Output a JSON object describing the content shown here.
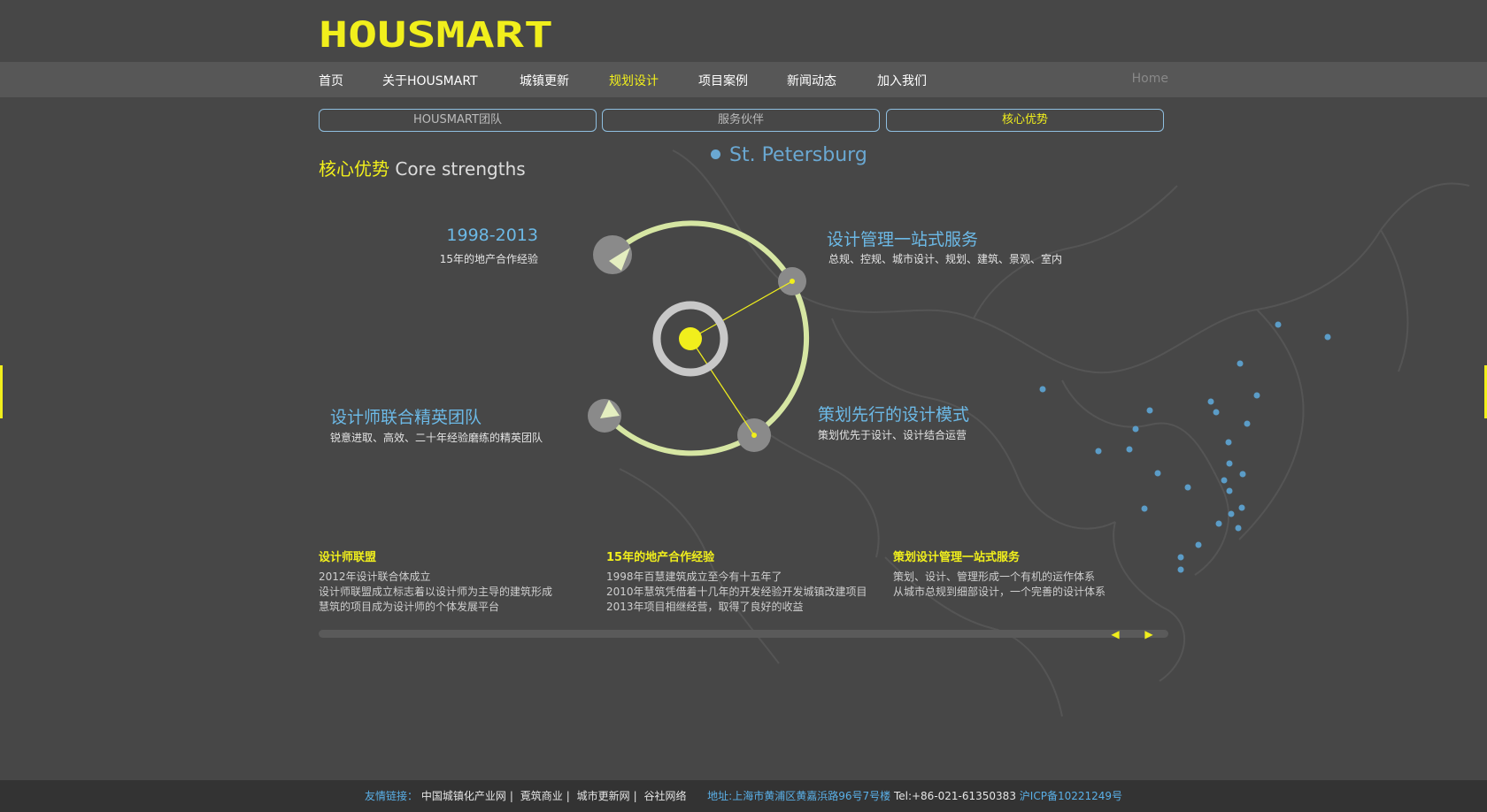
{
  "header": {
    "logo_text": "HOUSMART"
  },
  "nav": {
    "items": [
      {
        "label": "首页",
        "active": false
      },
      {
        "label": "关于HOUSMART",
        "active": false
      },
      {
        "label": "城镇更新",
        "active": false
      },
      {
        "label": "规划设计",
        "active": true
      },
      {
        "label": "项目案例",
        "active": false
      },
      {
        "label": "新闻动态",
        "active": false
      },
      {
        "label": "加入我们",
        "active": false
      }
    ],
    "home_label": "Home"
  },
  "subtabs": [
    {
      "label": "HOUSMART团队",
      "active": false
    },
    {
      "label": "服务伙伴",
      "active": false
    },
    {
      "label": "核心优势",
      "active": true
    }
  ],
  "section": {
    "title_cn": "核心优势",
    "title_en": " Core strengths"
  },
  "map": {
    "city_label": "St. Petersburg"
  },
  "callouts": {
    "top_left": {
      "title": "1998-2013",
      "subtitle": "15年的地产合作经验"
    },
    "top_right": {
      "title": "设计管理一站式服务",
      "subtitle": "总规、控规、城市设计、规划、建筑、景观、室内"
    },
    "bottom_left": {
      "title": "设计师联合精英团队",
      "subtitle": "锐意进取、高效、二十年经验磨练的精英团队"
    },
    "bottom_right": {
      "title": "策划先行的设计模式",
      "subtitle": "策划优先于设计、设计结合运营"
    }
  },
  "columns": [
    {
      "title": "设计师联盟",
      "lines": [
        "2012年设计联合体成立",
        "设计师联盟成立标志着以设计师为主导的建筑形成",
        "慧筑的项目成为设计师的个体发展平台"
      ]
    },
    {
      "title": "15年的地产合作经验",
      "lines": [
        "1998年百慧建筑成立至今有十五年了",
        "2010年慧筑凭借着十几年的开发经验开发城镇改建项目",
        "2013年项目相继经营，取得了良好的收益"
      ]
    },
    {
      "title": "策划设计管理一站式服务",
      "lines": [
        "策划、设计、管理形成一个有机的运作体系",
        "从城市总规到细部设计，一个完善的设计体系"
      ]
    }
  ],
  "colors": {
    "accent": "#f1ef1c",
    "blue": "#6cb9e6",
    "bg": "#474747"
  },
  "footer": {
    "links_label": "友情链接：",
    "links": [
      "中国城镇化产业网",
      "覔筑商业",
      "城市更新网",
      "谷社网络"
    ],
    "address": "地址:上海市黄浦区黄嘉浜路96号7号楼",
    "tel": "Tel:+86-021-61350383",
    "icp": "沪ICP备10221249号"
  }
}
